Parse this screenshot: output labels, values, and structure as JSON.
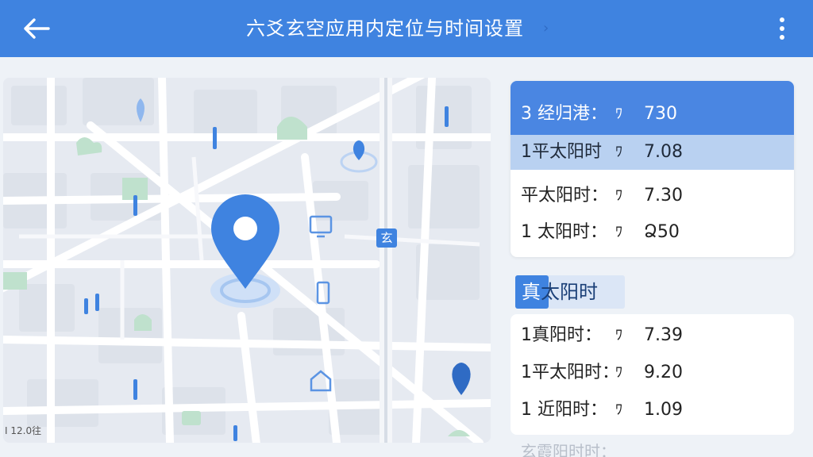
{
  "app": {
    "title": "六爻玄空应用内定位与时间设置",
    "title_chevron": "›",
    "accent_color": "#3f83e0"
  },
  "toolbar": {
    "back_icon": "arrow-left-icon",
    "more_icon": "more-vertical-icon"
  },
  "map": {
    "scale_label": "I 12.0往",
    "road_label": "玄",
    "icons": [
      "location-pin-icon",
      "tree-icon",
      "building-icon",
      "monitor-icon",
      "phone-icon",
      "home-icon"
    ]
  },
  "time_list": {
    "rows": [
      {
        "label": "3 经归港：",
        "sep": "ﾜ",
        "value": "730",
        "state": "selected"
      },
      {
        "label": "1平太阳时",
        "sep": "ﾜ",
        "value": "7.08",
        "state": "highlighted"
      },
      {
        "label": "平太阳时：",
        "sep": "ﾜ",
        "value": "7.30",
        "state": "normal"
      },
      {
        "label": "1 太阳时：",
        "sep": "ﾜ",
        "value": "Ձ50",
        "state": "normal"
      }
    ]
  },
  "section": {
    "title_first": "真",
    "title_rest": "太阳时"
  },
  "true_solar_list": {
    "rows": [
      {
        "label": "1真阳时：",
        "sep": "ﾜ",
        "value": "7.39"
      },
      {
        "label": "1平太阳时：",
        "sep": "ﾜ",
        "value": "9.20"
      },
      {
        "label": "1 近阳时：",
        "sep": "ﾜ",
        "value": "1.09"
      }
    ]
  },
  "footer_faded": "玄霞阳时时："
}
